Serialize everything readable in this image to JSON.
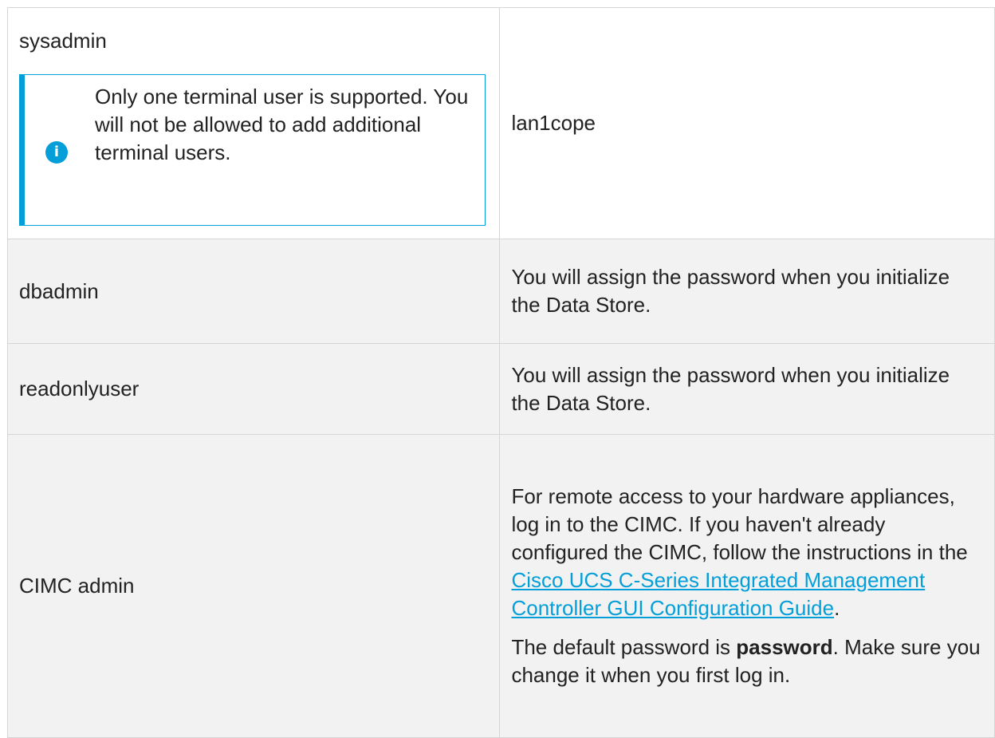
{
  "rows": [
    {
      "user": "sysadmin",
      "note": "Only one terminal user is supported. You will not be allowed to add additional terminal users.",
      "password": "lan1cope"
    },
    {
      "user": "dbadmin",
      "password": "You will assign the password when you initialize the Data Store."
    },
    {
      "user": "readonlyuser",
      "password": "You will assign the password when you initialize the Data Store."
    },
    {
      "user": "CIMC admin",
      "password_intro": "For remote access to your hardware appliances, log in to the CIMC. If you haven't already configured the CIMC, follow the instructions in the ",
      "password_link": "Cisco UCS C-Series Integrated Management Controller GUI Configuration Guide",
      "password_after_link": ".",
      "default_prefix": "The default password is ",
      "default_value": "password",
      "default_suffix": ". Make sure you change it when you first log in."
    }
  ],
  "icons": {
    "note": "info-icon",
    "note_glyph": "i"
  },
  "colors": {
    "accent": "#049fd9",
    "row_alt": "#f2f2f2",
    "border": "#d6d6d6"
  }
}
